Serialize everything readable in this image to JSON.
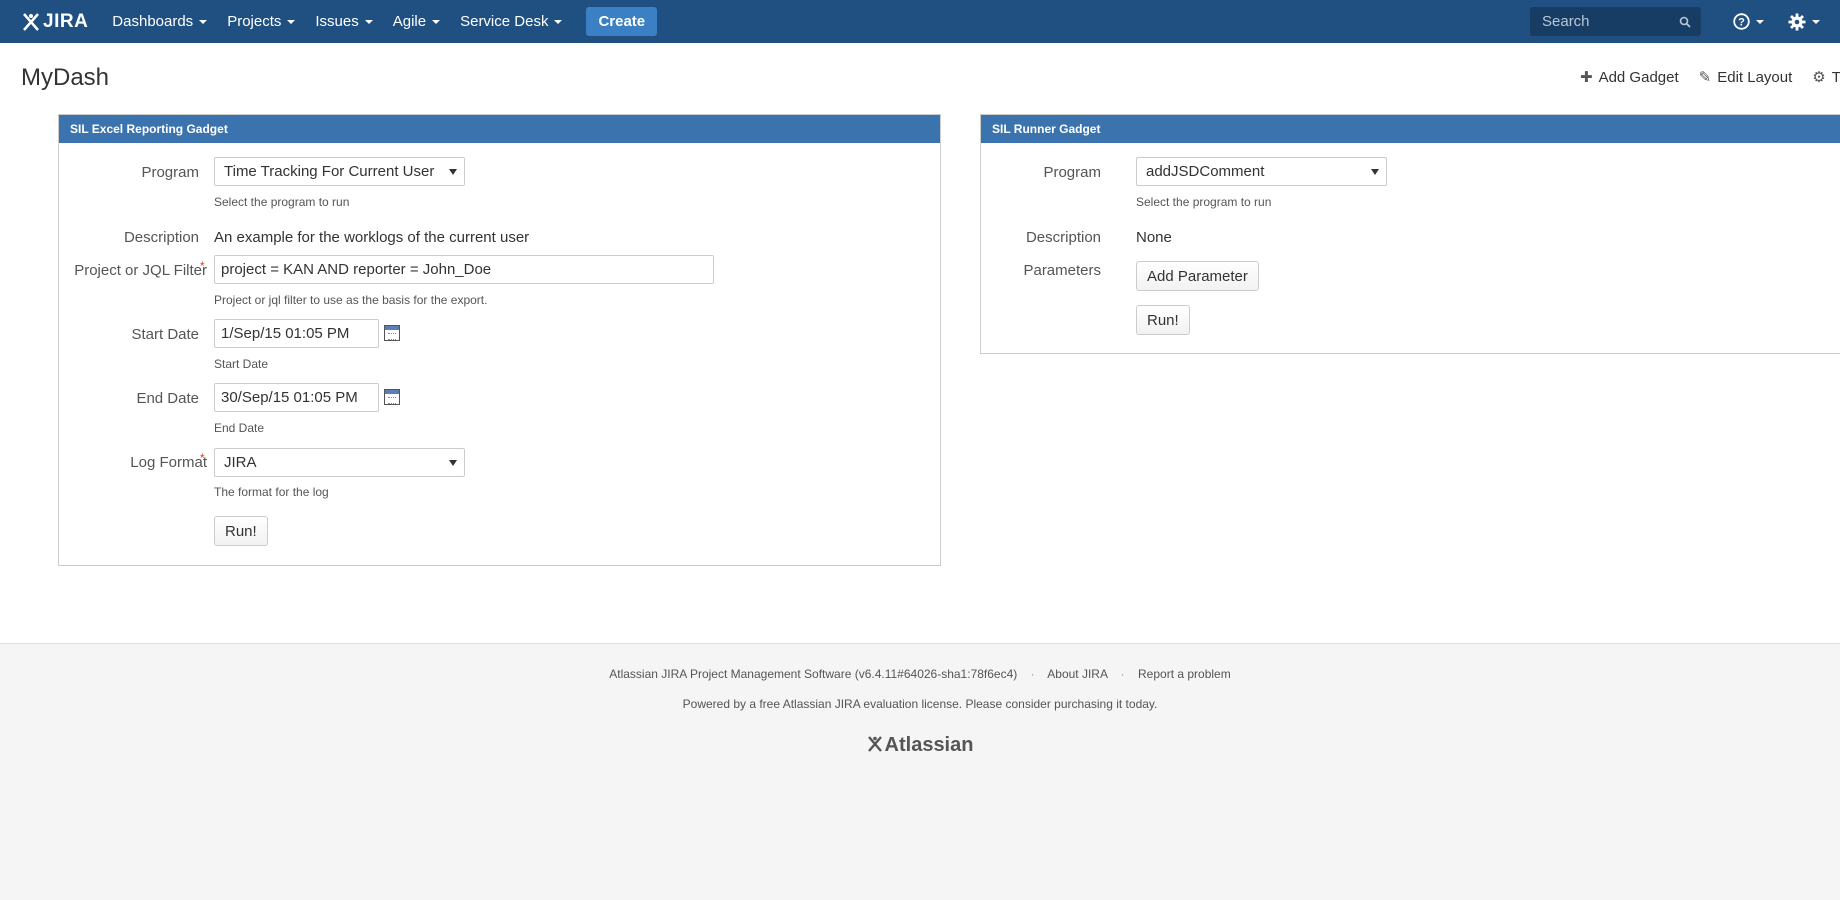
{
  "nav": {
    "logo": "JIRA",
    "items": [
      {
        "label": "Dashboards"
      },
      {
        "label": "Projects"
      },
      {
        "label": "Issues"
      },
      {
        "label": "Agile"
      },
      {
        "label": "Service Desk"
      }
    ],
    "create_label": "Create",
    "search_placeholder": "Search"
  },
  "page": {
    "title": "MyDash",
    "actions": {
      "add_gadget": "Add Gadget",
      "edit_layout": "Edit Layout",
      "tools": "To"
    }
  },
  "excel_gadget": {
    "title": "SIL Excel Reporting Gadget",
    "program_label": "Program",
    "program_value": "Time Tracking For Current User",
    "program_help": "Select the program to run",
    "description_label": "Description",
    "description_value": "An example for the worklogs of the current user",
    "filter_label": "Project or JQL Filter",
    "filter_value": "project = KAN AND reporter = John_Doe",
    "filter_help": "Project or jql filter to use as the basis for the export.",
    "start_label": "Start Date",
    "start_value": "1/Sep/15 01:05 PM",
    "start_help": "Start Date",
    "end_label": "End Date",
    "end_value": "30/Sep/15 01:05 PM",
    "end_help": "End Date",
    "format_label": "Log Format",
    "format_value": "JIRA",
    "format_help": "The format for the log",
    "run_label": "Run!",
    "required_mark": "*"
  },
  "runner_gadget": {
    "title": "SIL Runner Gadget",
    "program_label": "Program",
    "program_value": "addJSDComment",
    "program_help": "Select the program to run",
    "description_label": "Description",
    "description_value": "None",
    "parameters_label": "Parameters",
    "add_parameter_label": "Add Parameter",
    "run_label": "Run!"
  },
  "footer": {
    "product": "Atlassian JIRA Project Management Software (v6.4.11#64026-sha1:78f6ec4)",
    "about": "About JIRA",
    "report": "Report a problem",
    "separator": "·",
    "license": "Powered by a free Atlassian JIRA evaluation license. Please consider purchasing it today.",
    "logo": "Atlassian"
  },
  "colors": {
    "nav_bg": "#205081",
    "create_bg": "#3b7fc4",
    "gadget_header_bg": "#3b73af",
    "required": "#d04437"
  }
}
